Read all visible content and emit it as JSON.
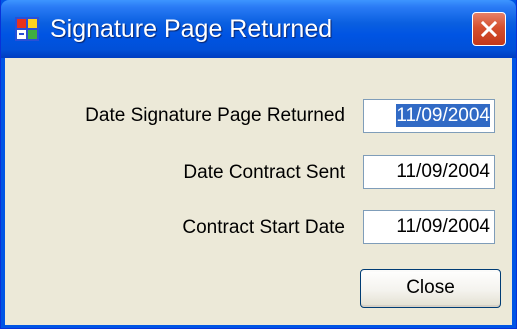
{
  "window": {
    "title": "Signature Page Returned",
    "app_icon": "windows-form-icon",
    "close_icon": "close-x-icon"
  },
  "form": {
    "fields": [
      {
        "label": "Date Signature Page Returned",
        "value": "11/09/2004",
        "selected": true
      },
      {
        "label": "Date Contract Sent",
        "value": "11/09/2004",
        "selected": false
      },
      {
        "label": "Contract Start Date",
        "value": "11/09/2004",
        "selected": false
      }
    ],
    "close_label": "Close"
  },
  "colors": {
    "titlebar": "#0054e3",
    "client_background": "#ece9d8",
    "selection": "#316ac5",
    "close_button_red": "#d5502e"
  }
}
